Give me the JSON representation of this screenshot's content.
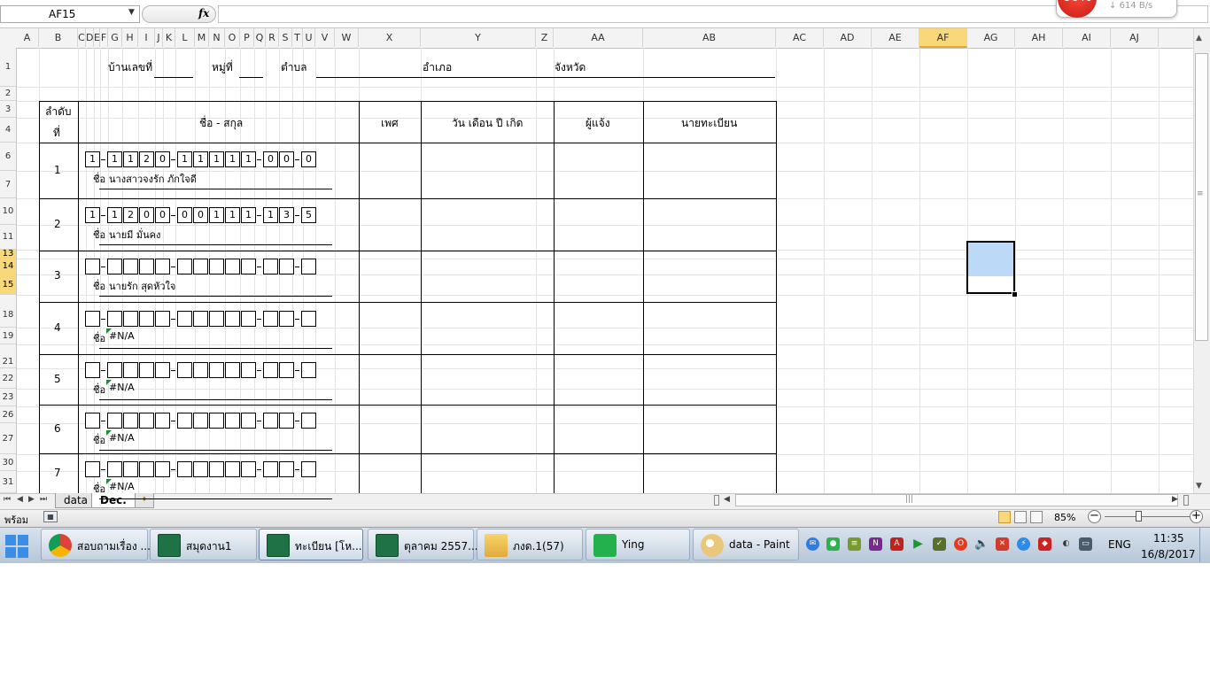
{
  "formula_bar": {
    "name_box": "AF15",
    "fx": "fx",
    "formula": ""
  },
  "net_speed": {
    "percent": "60%",
    "rate": "614 B/s"
  },
  "columns": [
    "A",
    "B",
    "C",
    "D",
    "E",
    "F",
    "G",
    "H",
    "I",
    "J",
    "K",
    "L",
    "M",
    "N",
    "O",
    "P",
    "Q",
    "R",
    "S",
    "T",
    "U",
    "V",
    "W",
    "X",
    "Y",
    "Z",
    "AA",
    "AB",
    "AC",
    "AD",
    "AE",
    "AF",
    "AG",
    "AH",
    "AI",
    "AJ"
  ],
  "selected_column": "AF",
  "rows": [
    "1",
    "2",
    "3",
    "4",
    "6",
    "7",
    "10",
    "11",
    "13",
    "14",
    "15",
    "18",
    "19",
    "21",
    "22",
    "23",
    "26",
    "27",
    "30",
    "31"
  ],
  "selected_rows": [
    "13",
    "14",
    "15"
  ],
  "sheet": {
    "header_line": {
      "house_no": "บ้านเลขที่",
      "moo": "หมู่ที่",
      "tambon": "ตำบล",
      "amphoe": "อำเภอ",
      "province": "จังหวัด"
    },
    "table_headers": {
      "order": "ลำดับ",
      "order2": "ที่",
      "name": "ชื่อ - สกุล",
      "sex": "เพศ",
      "dob": "วัน เดือน ปี เกิด",
      "informant": "ผู้แจ้ง",
      "registrar": "นายทะเบียน"
    },
    "name_prefix": "ชื่อ",
    "records": [
      {
        "no": "1",
        "id": [
          "1",
          "1",
          "1",
          "2",
          "0",
          "1",
          "1",
          "1",
          "1",
          "1",
          "0",
          "0",
          "0"
        ],
        "name": "นางสาวจงรัก  ภักใจดี",
        "na": false
      },
      {
        "no": "2",
        "id": [
          "1",
          "1",
          "2",
          "0",
          "0",
          "0",
          "0",
          "1",
          "1",
          "1",
          "1",
          "3",
          "5"
        ],
        "name": "นายมี  มั่นคง",
        "na": false
      },
      {
        "no": "3",
        "id": [
          "",
          "",
          "",
          "",
          "",
          "",
          "",
          "",
          "",
          "",
          "",
          "",
          ""
        ],
        "name": "นายรัก     สุดหัวใจ",
        "na": false
      },
      {
        "no": "4",
        "id": [
          "",
          "",
          "",
          "",
          "",
          "",
          "",
          "",
          "",
          "",
          "",
          "",
          ""
        ],
        "name": "#N/A",
        "na": true
      },
      {
        "no": "5",
        "id": [
          "",
          "",
          "",
          "",
          "",
          "",
          "",
          "",
          "",
          "",
          "",
          "",
          ""
        ],
        "name": "#N/A",
        "na": true
      },
      {
        "no": "6",
        "id": [
          "",
          "",
          "",
          "",
          "",
          "",
          "",
          "",
          "",
          "",
          "",
          "",
          ""
        ],
        "name": "#N/A",
        "na": true
      },
      {
        "no": "7",
        "id": [
          "",
          "",
          "",
          "",
          "",
          "",
          "",
          "",
          "",
          "",
          "",
          "",
          ""
        ],
        "name": "#N/A",
        "na": true
      }
    ]
  },
  "sheet_tabs": [
    {
      "label": "data",
      "active": false
    },
    {
      "label": "Dec.",
      "active": true
    }
  ],
  "status_bar": {
    "status": "พร้อม",
    "zoom": "85%",
    "zoom_level_percent": 85,
    "zoom_minus": "−",
    "zoom_plus": "+"
  },
  "taskbar": {
    "items": [
      {
        "label": "สอบถามเรื่อง ...",
        "icon": "chrome-icon",
        "active": false
      },
      {
        "label": "สมุดงาน1",
        "icon": "excel-icon",
        "active": false
      },
      {
        "label": "ทะเบียน  [โห...",
        "icon": "excel-icon",
        "active": true
      },
      {
        "label": "ตุลาคม 2557...",
        "icon": "excel-icon",
        "active": false
      },
      {
        "label": "ภงด.1(57)",
        "icon": "folder-icon",
        "active": false
      },
      {
        "label": "Ying",
        "icon": "line-icon",
        "active": false
      },
      {
        "label": "data - Paint",
        "icon": "paint-icon",
        "active": false
      }
    ],
    "language": "ENG",
    "time": "11:35",
    "date": "16/8/2017"
  }
}
